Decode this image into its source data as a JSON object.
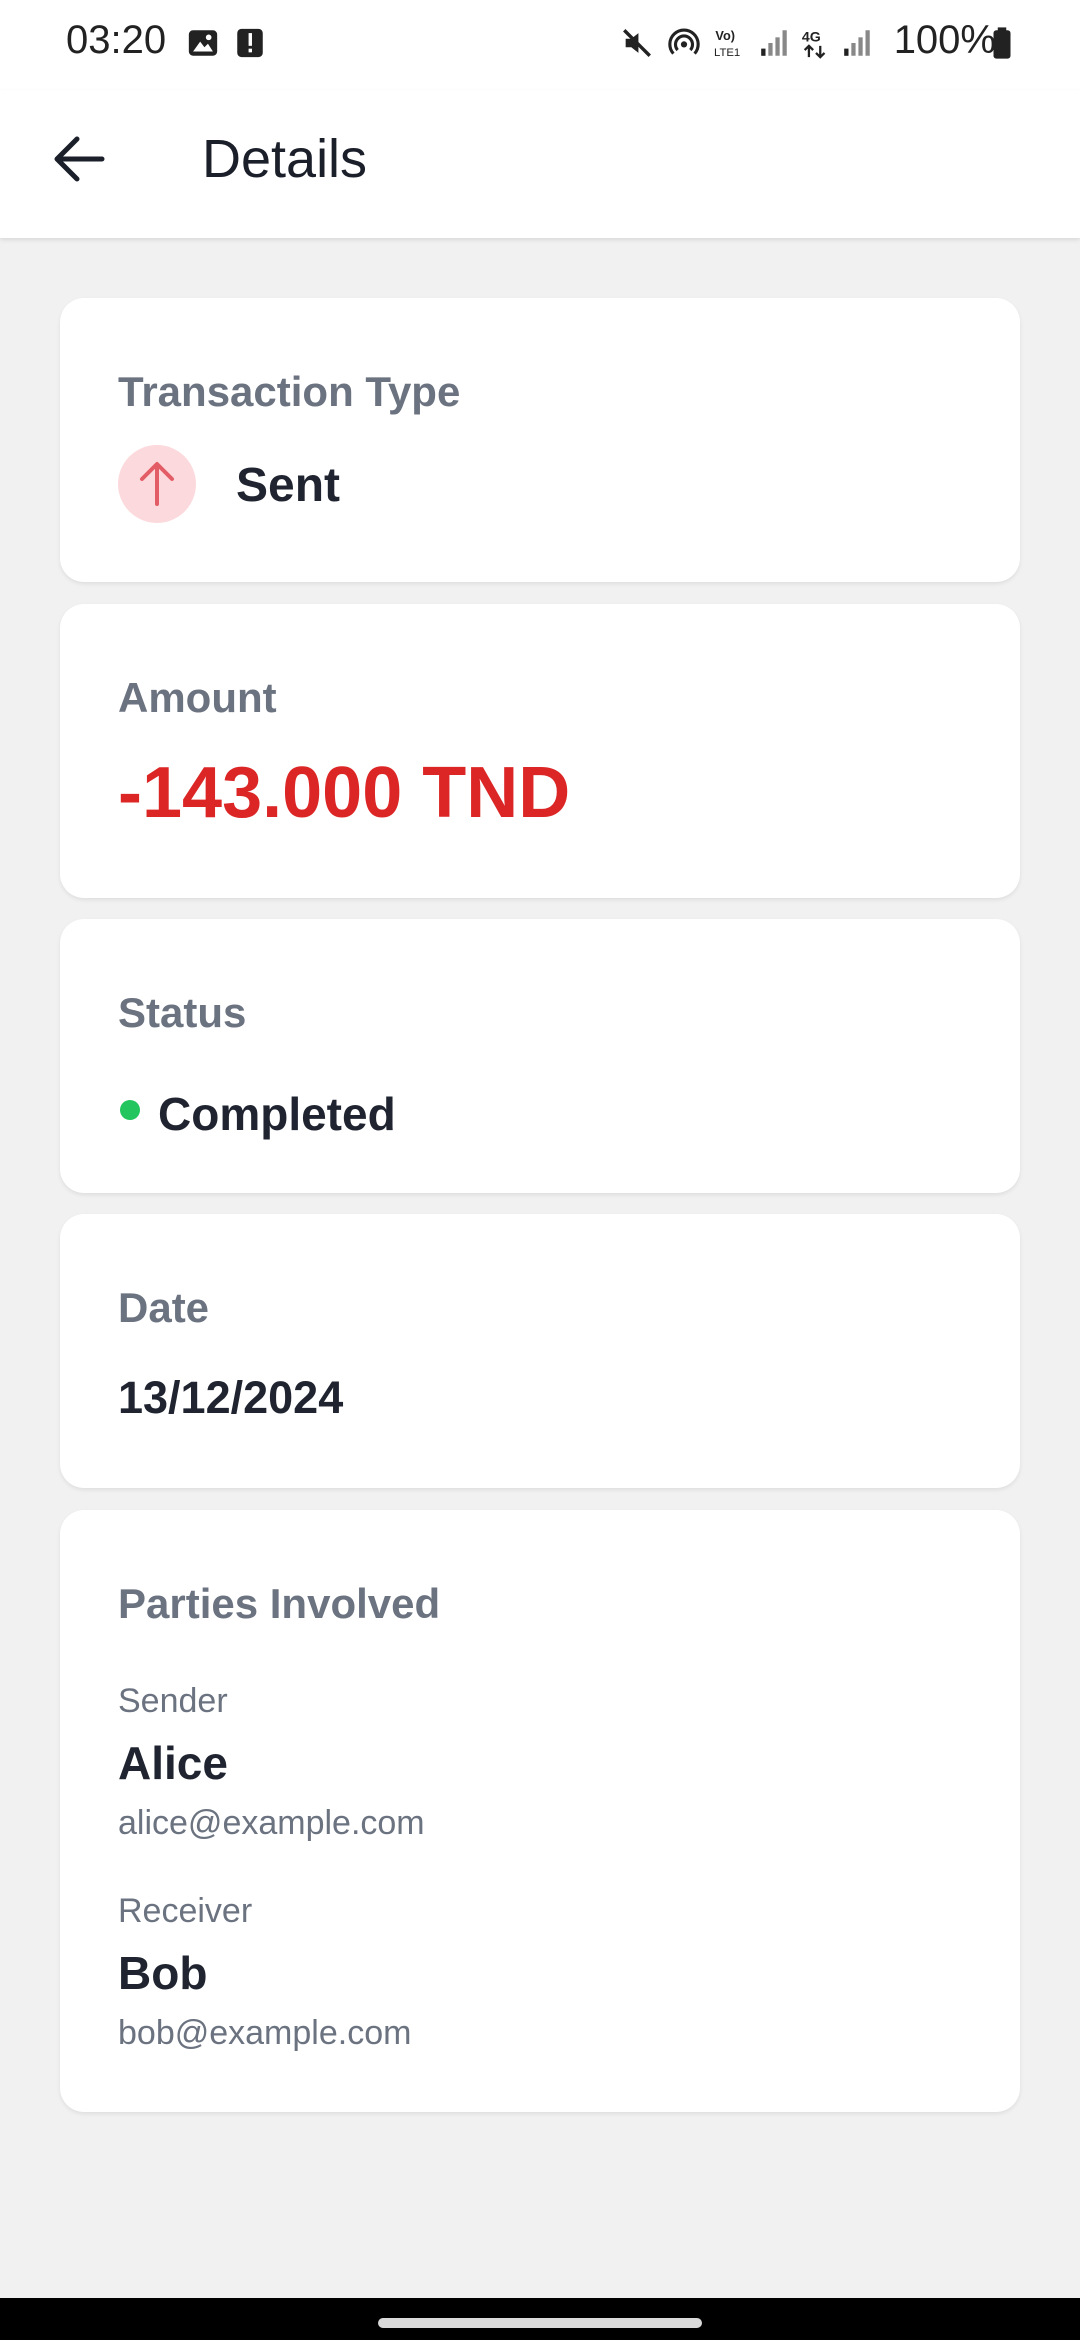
{
  "status_bar": {
    "time": "03:20",
    "battery": "100%",
    "left_icons": [
      "gallery-icon",
      "alert-icon"
    ],
    "right_icons": [
      "mute-icon",
      "hotspot-icon",
      "volte-icon",
      "signal-icon",
      "4g-icon",
      "signal-icon",
      "battery-icon"
    ]
  },
  "app_bar": {
    "title": "Details",
    "back_icon": "arrow-left-icon"
  },
  "transaction_type": {
    "label": "Transaction Type",
    "value": "Sent",
    "icon": "arrow-up-icon"
  },
  "amount": {
    "label": "Amount",
    "value": "-143.000 TND"
  },
  "status": {
    "label": "Status",
    "value": "Completed"
  },
  "date": {
    "label": "Date",
    "value": "13/12/2024"
  },
  "parties": {
    "label": "Parties Involved",
    "sender": {
      "role": "Sender",
      "name": "Alice",
      "email": "alice@example.com"
    },
    "receiver": {
      "role": "Receiver",
      "name": "Bob",
      "email": "bob@example.com"
    }
  },
  "colors": {
    "amount_negative": "#dc2626",
    "status_completed": "#22c55e",
    "sent_icon_bg": "#fcd9dc",
    "sent_icon": "#e35d66",
    "label_gray": "#6b7280",
    "background": "#f1f1f1"
  }
}
